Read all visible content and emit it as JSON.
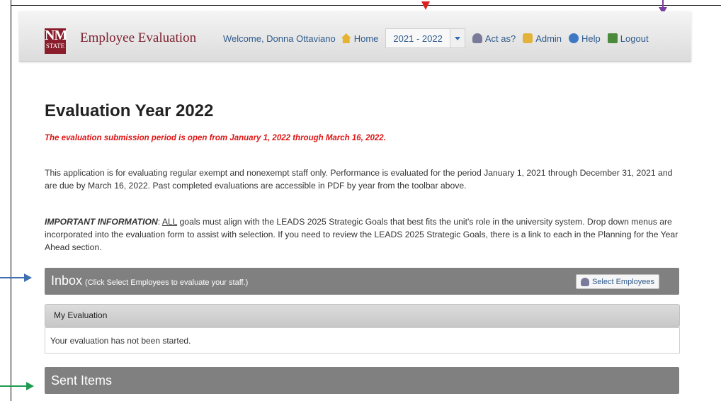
{
  "header": {
    "logo_top": "NM",
    "logo_bottom": "STATE",
    "app_title": "Employee Evaluation",
    "welcome": "Welcome, Donna Ottaviano",
    "nav": {
      "home": "Home",
      "year_selected": "2021 - 2022",
      "act_as": "Act as?",
      "admin": "Admin",
      "help": "Help",
      "logout": "Logout"
    }
  },
  "main": {
    "title": "Evaluation Year 2022",
    "notice": "The evaluation submission period is open from January 1, 2022 through March 16, 2022.",
    "para1": "This application is for evaluating regular exempt and nonexempt staff only. Performance is evaluated for the period January 1, 2021 through December 31, 2021 and are due by March 16, 2022. Past completed evaluations are accessible in PDF by year from the toolbar above.",
    "para2_label": "IMPORTANT INFORMATION",
    "para2_sep": ": ",
    "para2_all": "ALL",
    "para2_rest": " goals must align with the LEADS 2025 Strategic Goals that best fits the unit's role in the university system. Drop down menus are incorporated into the evaluation form to assist with selection. If you need to review the LEADS 2025 Strategic Goals, there is a link to each in the Planning for the Year Ahead section."
  },
  "inbox": {
    "title": "Inbox",
    "subtitle": "(Click Select Employees to evaluate your staff.)",
    "select_button": "Select Employees",
    "my_evaluation": "My Evaluation",
    "status": "Your evaluation has not been started."
  },
  "sent": {
    "title": "Sent Items"
  },
  "colors": {
    "brand": "#8a1c2c",
    "notice": "#e01414",
    "annotation_red": "#e01e1e",
    "annotation_purple": "#7a3fa0",
    "annotation_blue": "#3e6fb0",
    "annotation_green": "#1f9a52"
  }
}
